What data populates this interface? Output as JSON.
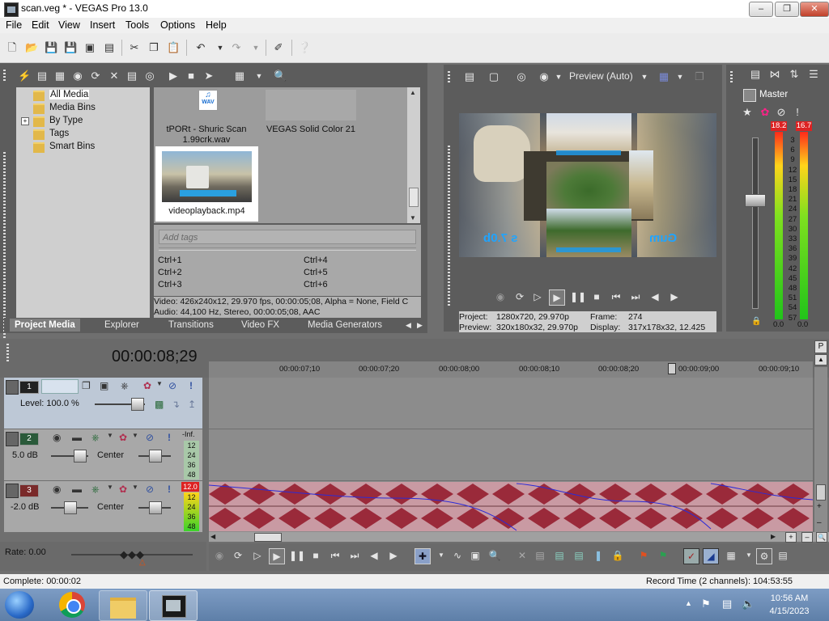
{
  "window": {
    "title": "scan.veg * - VEGAS Pro 13.0"
  },
  "menu": [
    "File",
    "Edit",
    "View",
    "Insert",
    "Tools",
    "Options",
    "Help"
  ],
  "project_media": {
    "tree": [
      "All Media",
      "Media Bins",
      "By Type",
      "Tags",
      "Smart Bins"
    ],
    "items": [
      {
        "name": "tPORt - Shuric Scan 1.99crk.wav",
        "badge": "WAV"
      },
      {
        "name": "VEGAS Solid Color 21"
      },
      {
        "name": "videoplayback.mp4"
      }
    ],
    "tags_placeholder": "Add tags",
    "shortcuts": [
      "Ctrl+1",
      "Ctrl+2",
      "Ctrl+3",
      "Ctrl+4",
      "Ctrl+5",
      "Ctrl+6"
    ],
    "info_video": "Video: 426x240x12, 29.970 fps, 00:00:05;08, Alpha = None, Field C",
    "info_audio": "Audio: 44,100 Hz, Stereo, 00:00:05;08, AAC",
    "tabs": [
      "Project Media",
      "Explorer",
      "Transitions",
      "Video FX",
      "Media Generators"
    ]
  },
  "preview": {
    "mode": "Preview (Auto)",
    "project_label": "Project:",
    "project_value": "1280x720, 29.970p",
    "preview_label": "Preview:",
    "preview_value": "320x180x32, 29.970p",
    "frame_label": "Frame:",
    "frame_value": "274",
    "display_label": "Display:",
    "display_value": "317x178x32, 12.425",
    "overlay_text_1": "Gum",
    "overlay_text_2": "s 7.0b"
  },
  "master": {
    "title": "Master",
    "peak_left": "18.2",
    "peak_right": "16.7",
    "scale": [
      "3",
      "6",
      "9",
      "12",
      "15",
      "18",
      "21",
      "24",
      "27",
      "30",
      "33",
      "36",
      "39",
      "42",
      "45",
      "48",
      "51",
      "54",
      "57"
    ],
    "bottom_left": "0.0",
    "bottom_right": "0.0"
  },
  "timeline": {
    "timecode": "00:00:08;29",
    "ruler": [
      "00:00:07;10",
      "00:00:07;20",
      "00:00:08;00",
      "00:00:08;10",
      "00:00:08;20",
      "00:00:09;00",
      "00:00:09;10"
    ],
    "track1": {
      "number": "1",
      "level_label": "Level: 100.0 %"
    },
    "track2": {
      "number": "2",
      "volume": "5.0 dB",
      "pan": "Center",
      "meter_top": "-Inf.",
      "meter": [
        "12",
        "24",
        "36",
        "48"
      ]
    },
    "track3": {
      "number": "3",
      "volume": "-2.0 dB",
      "pan": "Center",
      "meter_top": "12.0",
      "meter": [
        "12",
        "24",
        "36",
        "48"
      ]
    }
  },
  "rate": {
    "label": "Rate: 0.00"
  },
  "status": {
    "left": "Complete: 00:00:02",
    "right": "Record Time (2 channels): 104:53:55"
  },
  "clock": {
    "time": "10:56 AM",
    "date": "4/15/2023"
  }
}
